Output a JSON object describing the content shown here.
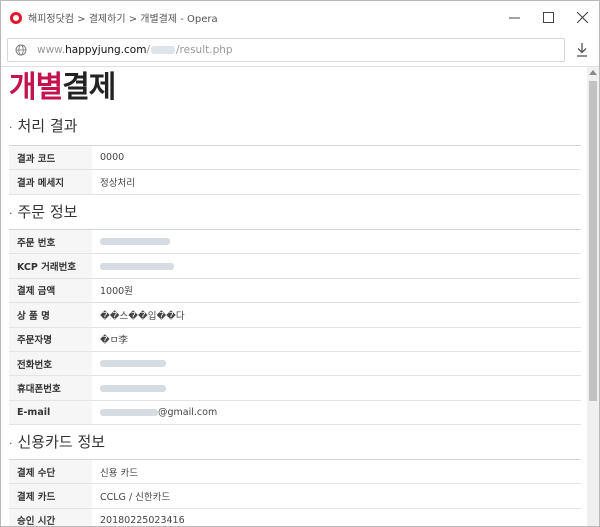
{
  "window": {
    "title": "해피정닷컴 > 결제하기 > 개별결제 - Opera",
    "controls": {
      "minimize": "—",
      "maximize": "☐",
      "close": "✕"
    }
  },
  "address": {
    "scheme_host_prefix": "www.",
    "host": "happyjung.com",
    "path_suffix": "/result.php"
  },
  "page": {
    "title_accent": "개별",
    "title_rest": "결제"
  },
  "sections": {
    "result": {
      "heading": "처리 결과",
      "rows": [
        {
          "label": "결과 코드",
          "value": "0000"
        },
        {
          "label": "결과 메세지",
          "value": "정상처리"
        }
      ]
    },
    "order": {
      "heading": "주문 정보",
      "rows": [
        {
          "label": "주문 번호",
          "value": ""
        },
        {
          "label": "KCP 거래번호",
          "value": ""
        },
        {
          "label": "결제 금액",
          "value": "1000원"
        },
        {
          "label": "상 품 명",
          "value": "��스��입��다"
        },
        {
          "label": "주문자명",
          "value": "�ㅁ李"
        },
        {
          "label": "전화번호",
          "value": ""
        },
        {
          "label": "휴대폰번호",
          "value": ""
        },
        {
          "label": "E-mail",
          "value": "@gmail.com"
        }
      ]
    },
    "card": {
      "heading": "신용카드 정보",
      "rows": [
        {
          "label": "결제 수단",
          "value": "신용 카드"
        },
        {
          "label": "결제 카드",
          "value": "CCLG / 신한카드"
        },
        {
          "label": "승인 시간",
          "value": "20180225023416"
        }
      ]
    }
  },
  "colors": {
    "accent": "#c4124f",
    "label_bg": "#f6f6f6"
  }
}
